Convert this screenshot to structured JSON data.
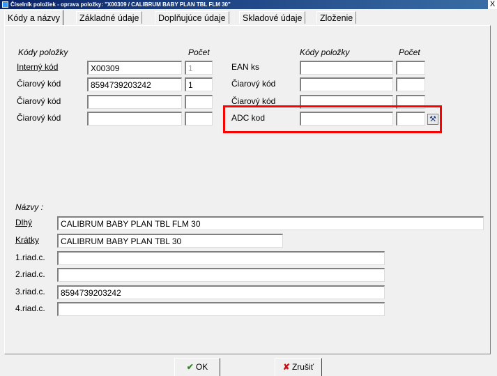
{
  "window": {
    "title": "Číselník položiek - oprava položky: \"X00309 / CALIBRUM BABY PLAN TBL FLM 30\"",
    "close_glyph": "X"
  },
  "tabs": [
    {
      "label": "Kódy a názvy"
    },
    {
      "label": "Základné údaje"
    },
    {
      "label": "Doplňujúce údaje"
    },
    {
      "label": "Skladové údaje"
    },
    {
      "label": "Zloženie"
    }
  ],
  "left_codes": {
    "header_codes": "Kódy položky",
    "header_count": "Počet",
    "rows": [
      {
        "label": "Interný kód",
        "value": "X00309",
        "count": "1"
      },
      {
        "label": "Čiarový kód",
        "value": "8594739203242",
        "count": "1"
      },
      {
        "label": "Čiarový kód",
        "value": "",
        "count": ""
      },
      {
        "label": "Čiarový kód",
        "value": "",
        "count": ""
      }
    ]
  },
  "right_codes": {
    "header_codes": "Kódy položky",
    "header_count": "Počet",
    "rows": [
      {
        "label": "EAN ks",
        "value": "",
        "count": ""
      },
      {
        "label": "Čiarový kód",
        "value": "",
        "count": ""
      },
      {
        "label": "Čiarový kód",
        "value": "",
        "count": ""
      },
      {
        "label": "ADC kod",
        "value": "",
        "count": ""
      }
    ]
  },
  "names": {
    "header": "Názvy :",
    "long_label": "Dlhý",
    "long_value": "CALIBRUM BABY PLAN TBL FLM 30",
    "short_label": "Krátky",
    "short_value": "CALIBRUM BABY PLAN TBL 30",
    "lines": [
      {
        "label": "1.riad.c.",
        "value": ""
      },
      {
        "label": "2.riad.c.",
        "value": ""
      },
      {
        "label": "3.riad.c.",
        "value": "8594739203242"
      },
      {
        "label": "4.riad.c.",
        "value": ""
      }
    ]
  },
  "buttons": {
    "ok_label": "OK",
    "cancel_label": "Zrušiť"
  },
  "icons": {
    "ok": "checkmark-icon",
    "cancel": "x-icon",
    "lookup": "wrench-icon"
  },
  "colors": {
    "highlight": "#ff0000",
    "titlebar": "#0a246a",
    "ok_check": "#2e8b22",
    "cancel_x": "#cc1111"
  }
}
